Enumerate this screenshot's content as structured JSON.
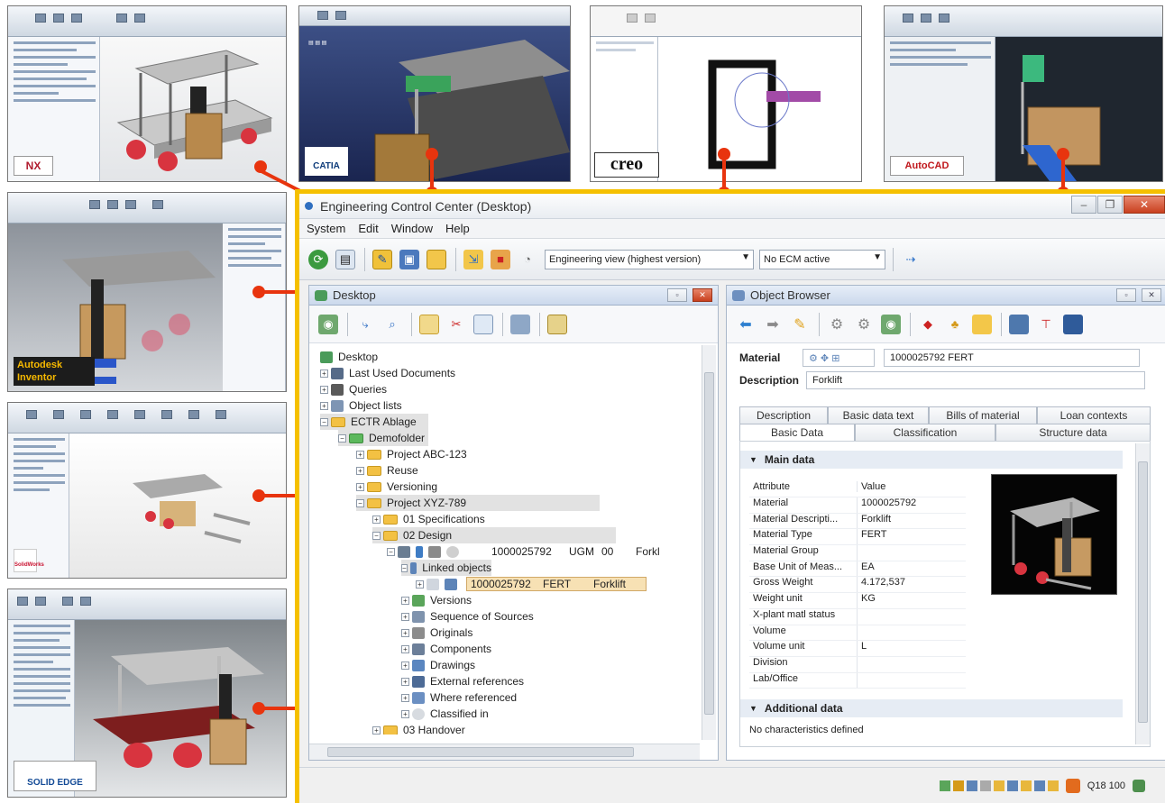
{
  "window": {
    "title": "Engineering Control Center (Desktop)"
  },
  "menu": [
    "System",
    "Edit",
    "Window",
    "Help"
  ],
  "toolbar": {
    "view_select": "Engineering view (highest version)",
    "ecm_select": "No ECM active"
  },
  "cad_logos": {
    "nx": "NX",
    "catia": "CATIA",
    "creo": "creo",
    "autocad": "AutoCAD",
    "inventor": "Autodesk Inventor",
    "solidworks": "SolidWorks",
    "solidedge": "SOLID EDGE"
  },
  "desktop_pane": {
    "title": "Desktop",
    "tree": [
      {
        "label": "Desktop"
      },
      {
        "label": "Last Used Documents"
      },
      {
        "label": "Queries"
      },
      {
        "label": "Object lists"
      },
      {
        "label": "ECTR Ablage"
      },
      {
        "label": "Demofolder"
      },
      {
        "label": "Project ABC-123"
      },
      {
        "label": "Reuse"
      },
      {
        "label": "Versioning"
      },
      {
        "label": "Project XYZ-789"
      },
      {
        "label": "01 Specifications"
      },
      {
        "label": "02 Design"
      },
      {
        "label": "1000025792",
        "col2": "UGM",
        "col3": "00",
        "col4": "Forkl"
      },
      {
        "label": "Linked objects"
      },
      {
        "label": "1000025792",
        "col2": "FERT",
        "col3": "Forklift"
      },
      {
        "label": "Versions"
      },
      {
        "label": "Sequence of Sources"
      },
      {
        "label": "Originals"
      },
      {
        "label": "Components"
      },
      {
        "label": "Drawings"
      },
      {
        "label": "External references"
      },
      {
        "label": "Where referenced"
      },
      {
        "label": "Classified in"
      },
      {
        "label": "03 Handover"
      }
    ]
  },
  "object_browser": {
    "title": "Object Browser",
    "material_label": "Material",
    "material_value": "1000025792   FERT",
    "description_label": "Description",
    "description_value": "Forklift",
    "tabs_row1": [
      "Description",
      "Basic data text",
      "Bills of material",
      "Loan contexts"
    ],
    "tabs_row2": [
      "Basic Data",
      "Classification",
      "Structure data"
    ],
    "main_section": "Main data",
    "attr_header": {
      "attribute": "Attribute",
      "value": "Value"
    },
    "attributes": [
      {
        "k": "Material",
        "v": "1000025792"
      },
      {
        "k": "Material Descripti...",
        "v": "Forklift"
      },
      {
        "k": "Material Type",
        "v": "FERT"
      },
      {
        "k": "Material Group",
        "v": ""
      },
      {
        "k": "Base Unit of Meas...",
        "v": "EA"
      },
      {
        "k": "Gross Weight",
        "v": "4.172,537"
      },
      {
        "k": "Weight unit",
        "v": "KG"
      },
      {
        "k": "X-plant matl status",
        "v": ""
      },
      {
        "k": "Volume",
        "v": ""
      },
      {
        "k": "Volume unit",
        "v": "L"
      },
      {
        "k": "Division",
        "v": ""
      },
      {
        "k": "Lab/Office",
        "v": ""
      }
    ],
    "additional_section": "Additional data",
    "no_characteristics": "No characteristics defined"
  },
  "status": {
    "client": "Q18 100"
  },
  "colors": {
    "accent": "#f5c000",
    "connector": "#e8340e"
  }
}
